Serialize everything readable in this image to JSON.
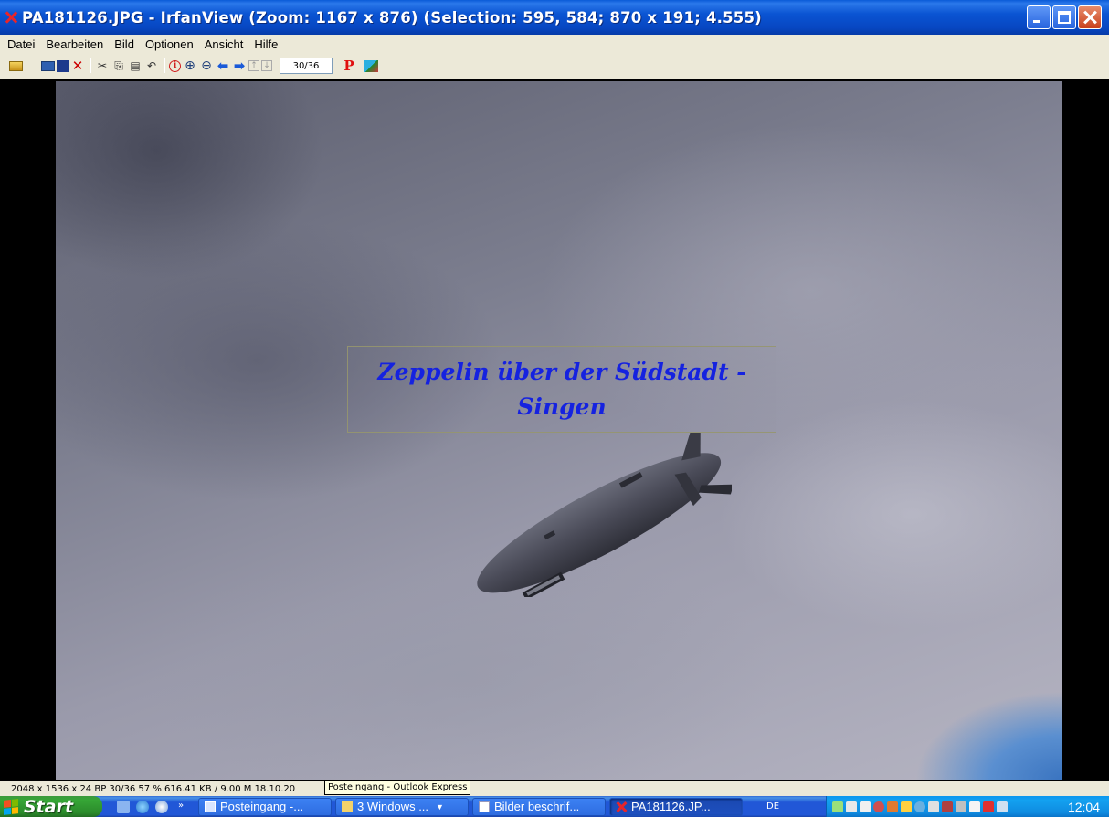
{
  "window": {
    "title": "PA181126.JPG - IrfanView (Zoom: 1167 x 876) (Selection: 595, 584; 870 x 191; 4.555)"
  },
  "menu": {
    "items": [
      "Datei",
      "Bearbeiten",
      "Bild",
      "Optionen",
      "Ansicht",
      "Hilfe"
    ]
  },
  "toolbar": {
    "icons": [
      "open-icon",
      "slideshow-icon",
      "save-icon",
      "delete-icon",
      "cut-icon",
      "copy-icon",
      "paste-icon",
      "undo-icon",
      "info-icon",
      "zoom-in-icon",
      "zoom-out-icon",
      "previous-icon",
      "next-icon",
      "first-icon",
      "last-icon",
      "paint-icon"
    ],
    "counter": "30/36",
    "print_label": "P"
  },
  "image": {
    "caption": "Zeppelin über der Südstadt -\nSingen",
    "caption_color": "#1522e0"
  },
  "statusbar": {
    "text": "2048 x 1536 x 24 BP 30/36  57 % 616.41 KB / 9.00 M 18.10.20"
  },
  "tooltip": {
    "text": "Posteingang - Outlook Express"
  },
  "taskbar": {
    "start_label": "Start",
    "quicklaunch_more": "»",
    "tasks": [
      {
        "label": "Posteingang -...",
        "icon": "mail-icon"
      },
      {
        "label": "3 Windows ...",
        "icon": "folder-icon"
      },
      {
        "label": "Bilder beschrif...",
        "icon": "document-icon"
      },
      {
        "label": "PA181126.JP...",
        "icon": "irfanview-icon"
      }
    ],
    "language": "DE",
    "clock": "12:04"
  },
  "colors": {
    "titlebar": "#0a54d3",
    "chrome": "#ece9d8",
    "taskbar": "#2157d7",
    "start": "#2b8b2b",
    "tray": "#0f8be0"
  }
}
